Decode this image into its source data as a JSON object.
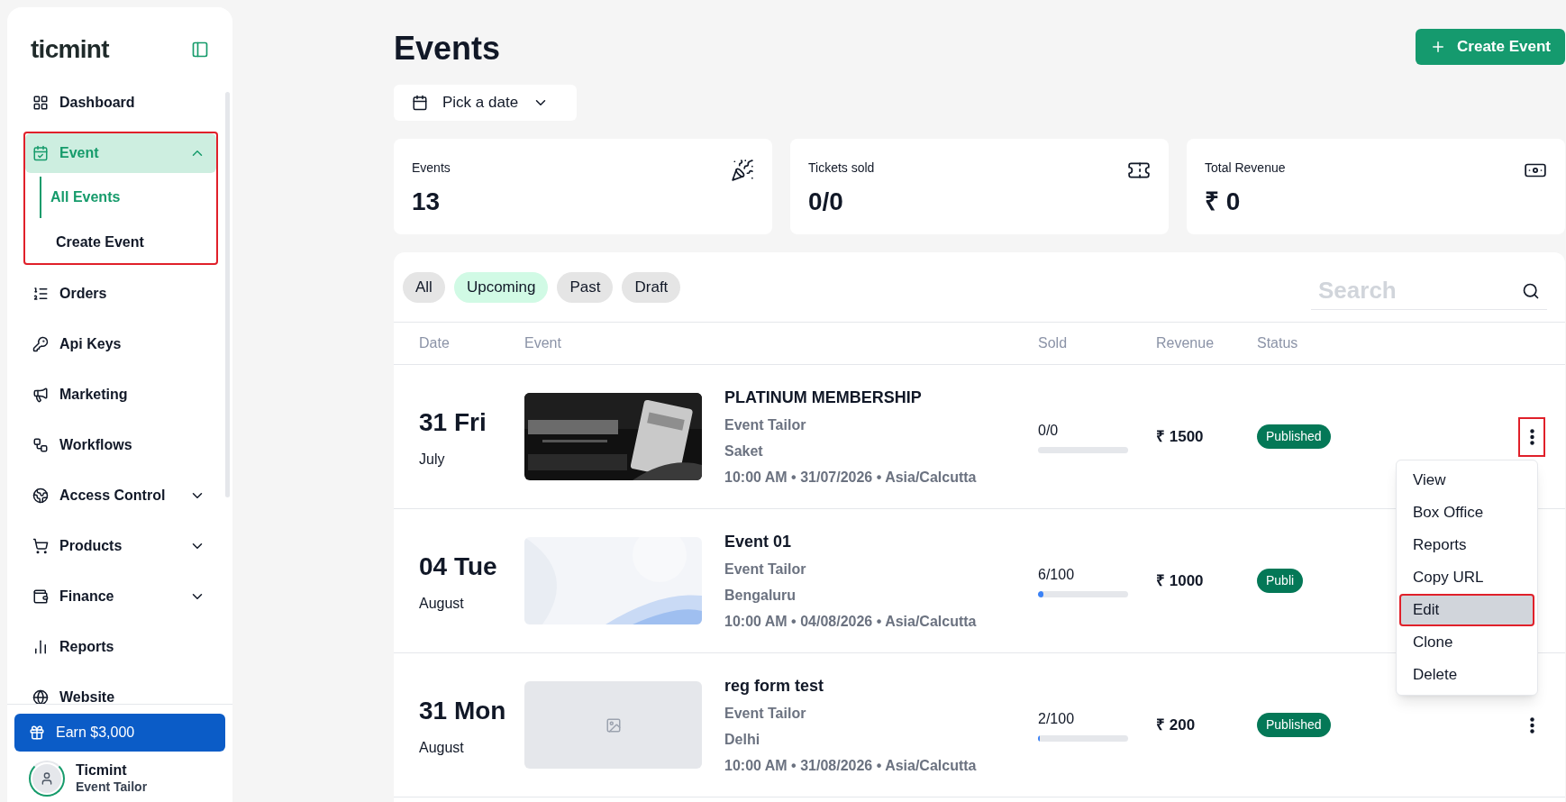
{
  "sidebar": {
    "logo": "ticmint",
    "items": [
      {
        "label": "Dashboard",
        "selected": false,
        "annotated": false
      },
      {
        "label": "Event",
        "expanded": true,
        "selected": true,
        "annotated": true,
        "children": [
          {
            "label": "All Events",
            "selected": true
          },
          {
            "label": "Create Event",
            "selected": false
          }
        ]
      },
      {
        "label": "Orders",
        "selected": false,
        "annotated": false
      },
      {
        "label": "Api Keys",
        "selected": false,
        "annotated": false
      },
      {
        "label": "Marketing",
        "selected": false,
        "annotated": false
      },
      {
        "label": "Workflows",
        "selected": false,
        "annotated": false
      },
      {
        "label": "Access Control",
        "expanded": false,
        "selected": false,
        "annotated": false
      },
      {
        "label": "Products",
        "expanded": false,
        "selected": false,
        "annotated": false
      },
      {
        "label": "Finance",
        "expanded": false,
        "selected": false,
        "annotated": false
      },
      {
        "label": "Reports",
        "selected": false,
        "annotated": false
      },
      {
        "label": "Website",
        "selected": false,
        "annotated": false
      }
    ],
    "earn_button": "Earn $3,000",
    "user": {
      "name": "Ticmint",
      "subtitle": "Event Tailor"
    }
  },
  "page": {
    "title": "Events",
    "create_button": "Create Event",
    "date_picker": "Pick a date"
  },
  "stats": [
    {
      "label": "Events",
      "value": "13"
    },
    {
      "label": "Tickets sold",
      "value": "0/0"
    },
    {
      "label": "Total Revenue",
      "value": "₹ 0"
    }
  ],
  "filters": [
    {
      "label": "All",
      "selected": false
    },
    {
      "label": "Upcoming",
      "selected": true
    },
    {
      "label": "Past",
      "selected": false
    },
    {
      "label": "Draft",
      "selected": false
    }
  ],
  "search": {
    "placeholder": "Search"
  },
  "table": {
    "columns": [
      "Date",
      "Event",
      "Sold",
      "Revenue",
      "Status"
    ],
    "rows": [
      {
        "day": "31 Fri",
        "month": "July",
        "has_image": true,
        "title": "PLATINUM MEMBERSHIP",
        "organizer": "Event Tailor",
        "venue": "Saket",
        "when": "10:00 AM • 31/07/2026 • Asia/Calcutta",
        "sold": "0/0",
        "revenue": "₹ 1500",
        "status": "Published",
        "menu_open": true,
        "annotated": true
      },
      {
        "day": "04 Tue",
        "month": "August",
        "has_image": true,
        "title": "Event 01",
        "organizer": "Event Tailor",
        "venue": "Bengaluru",
        "when": "10:00 AM • 04/08/2026 • Asia/Calcutta",
        "sold": "6/100",
        "level": 0.06,
        "revenue": "₹ 1000",
        "status": "Publi"
      },
      {
        "day": "31 Mon",
        "month": "August",
        "has_image": false,
        "title": "reg form test",
        "organizer": "Event Tailor",
        "venue": "Delhi",
        "when": "10:00 AM • 31/08/2026 • Asia/Calcutta",
        "sold": "2/100",
        "level": 0.02,
        "revenue": "₹ 200",
        "status": "Published",
        "annotated": false
      }
    ]
  },
  "row_menu": {
    "items": [
      {
        "label": "View",
        "selected": false,
        "annotated": false
      },
      {
        "label": "Box Office",
        "selected": false,
        "annotated": false
      },
      {
        "label": "Reports",
        "selected": false,
        "annotated": false
      },
      {
        "label": "Copy URL",
        "selected": false,
        "annotated": false
      },
      {
        "label": "Edit",
        "selected": true,
        "annotated": true
      },
      {
        "label": "Clone",
        "selected": false,
        "annotated": false
      },
      {
        "label": "Delete",
        "selected": false,
        "annotated": false
      }
    ]
  }
}
